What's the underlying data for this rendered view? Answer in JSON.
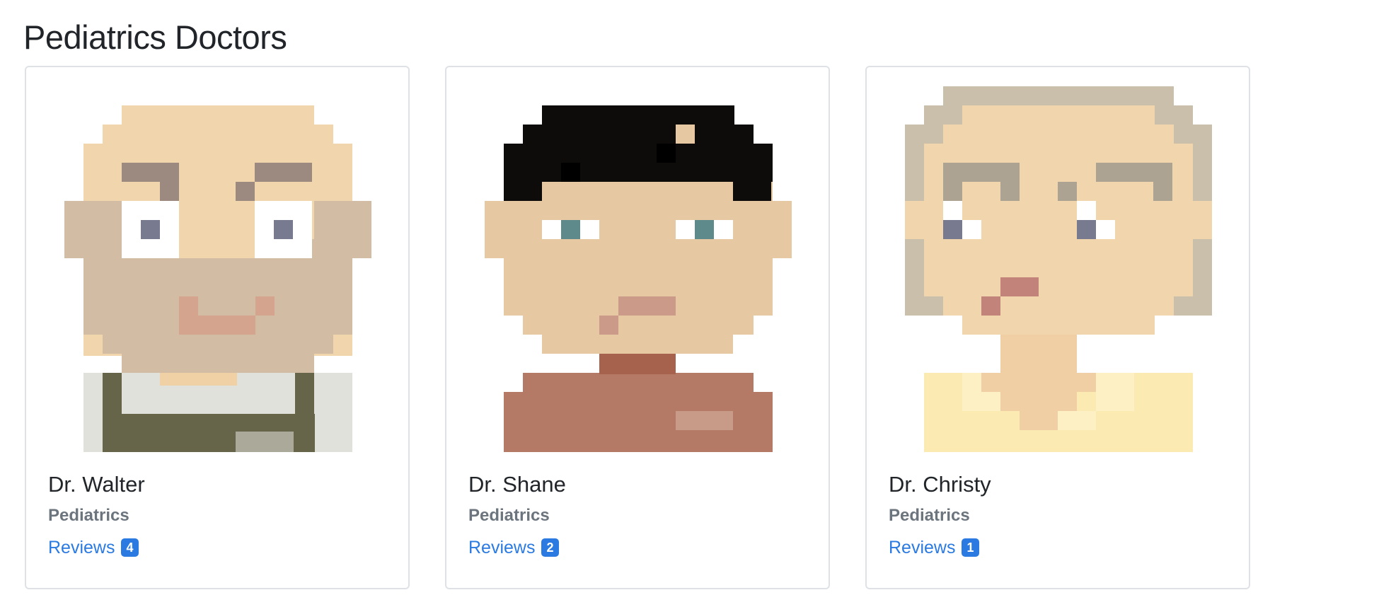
{
  "page": {
    "title": "Pediatrics Doctors"
  },
  "doctors": [
    {
      "name": "Dr. Walter",
      "specialty": "Pediatrics",
      "reviews_label": "Reviews",
      "reviews_count": "4"
    },
    {
      "name": "Dr. Shane",
      "specialty": "Pediatrics",
      "reviews_label": "Reviews",
      "reviews_count": "2"
    },
    {
      "name": "Dr. Christy",
      "specialty": "Pediatrics",
      "reviews_label": "Reviews",
      "reviews_count": "1"
    }
  ],
  "colors": {
    "link": "#2a7ae2",
    "badge": "#2a7ae2",
    "muted": "#6c757d",
    "card_border": "#dee2e6"
  }
}
